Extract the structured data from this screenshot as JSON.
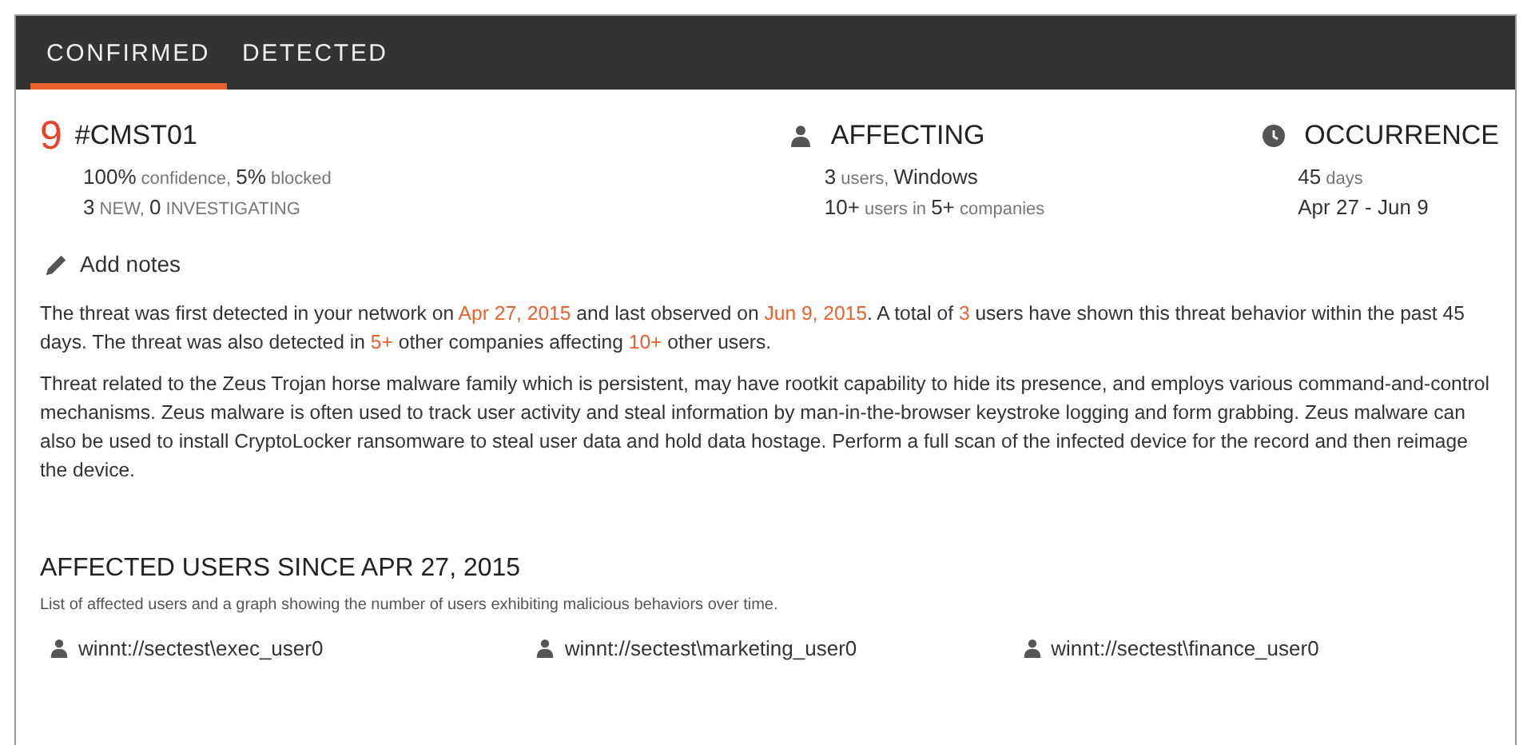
{
  "tabs": [
    {
      "label": "CONFIRMED",
      "selected": true
    },
    {
      "label": "DETECTED",
      "selected": false
    }
  ],
  "threat": {
    "count": "9",
    "id": "#CMST01",
    "lines": [
      "**100%** confidence, **5%** blocked",
      "**3** NEW, **0** INVESTIGATING"
    ]
  },
  "affecting": {
    "title": "AFFECTING",
    "lines": [
      "**3** users, **Windows**",
      "**10+** users in **5+** companies"
    ]
  },
  "occurrence": {
    "title": "OCCURRENCE",
    "lines": [
      "**45** days",
      "**Apr 27 - Jun 9**"
    ]
  },
  "add_notes": "Add notes",
  "description": [
    "The threat was first detected in your network on **Apr 27, 2015** and last observed on **Jun 9, 2015**. A total of **3** users have shown this threat behavior within the past 45 days. The threat was also detected in **5+** other companies affecting **10+** other users.",
    "Threat related to the Zeus Trojan horse malware family which is persistent, may have rootkit capability to hide its presence, and employs various command-and-control mechanisms. Zeus malware is often used to track user activity and steal information by man-in-the-browser keystroke logging and form grabbing. Zeus malware can also be used to install CryptoLocker ransomware to steal user data and hold data hostage. Perform a full scan of the infected device for the record and then reimage the device."
  ],
  "affected_users": {
    "title": "AFFECTED USERS SINCE APR 27, 2015",
    "subtitle": "List of affected users and a graph showing the number of users exhibiting malicious behaviors over time.",
    "users": [
      "winnt://sectest\\exec_user0",
      "winnt://sectest\\marketing_user0",
      "winnt://sectest\\finance_user0"
    ]
  }
}
